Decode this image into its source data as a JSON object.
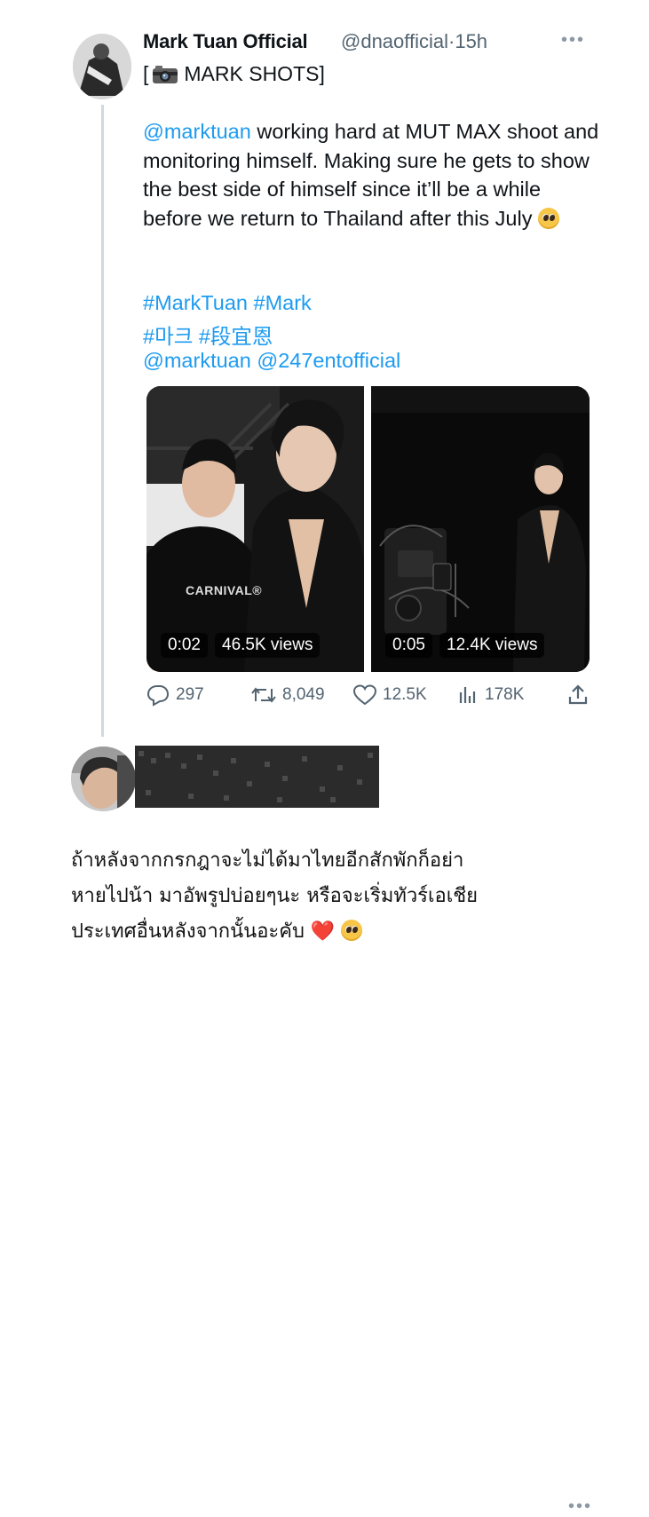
{
  "tweet": {
    "author_name": "Mark Tuan Official",
    "author_handle": "@dnaofficial",
    "separator": "·",
    "time": "15h",
    "more_icon": "more-horizontal-icon",
    "heading_prefix": "[",
    "heading_icon": "camera-icon",
    "heading_text": "MARK SHOTS]",
    "body_mention": "@marktuan",
    "body_text": " working hard at MUT MAX shoot and monitoring himself. Making sure he gets to show the best side of himself since it’ll be a while before we return to Thailand after this July",
    "body_emoji": "pleading-face-emoji",
    "hashtags_line1": "#MarkTuan #Mark",
    "hashtags_line2": "#마크 #段宜恩",
    "mentions_line": "@marktuan @247entofficial",
    "media": [
      {
        "duration": "0:02",
        "views": "46.5K views",
        "shirt_text": "CARNIVAL®"
      },
      {
        "duration": "0:05",
        "views": "12.4K views"
      }
    ],
    "actions": {
      "replies": "297",
      "retweets": "8,049",
      "likes": "12.5K",
      "views": "178K"
    }
  },
  "reply": {
    "name_redacted": true,
    "more_icon": "more-horizontal-icon",
    "text_line1": "ถ้าหลังจากกรกฎาจะไม่ได้มาไทยอีกสักพักก็อย่า",
    "text_line2": "หายไปน้า มาอัพรูปบ่อยๆนะ หรือจะเริ่มทัวร์เอเชีย",
    "text_line3": "ประเทศอื่นหลังจากนั้นอะคับ",
    "heart": "❤️"
  },
  "colors": {
    "link": "#1d9bf0",
    "secondary_text": "#536471",
    "thread_line": "#cfd9de"
  }
}
